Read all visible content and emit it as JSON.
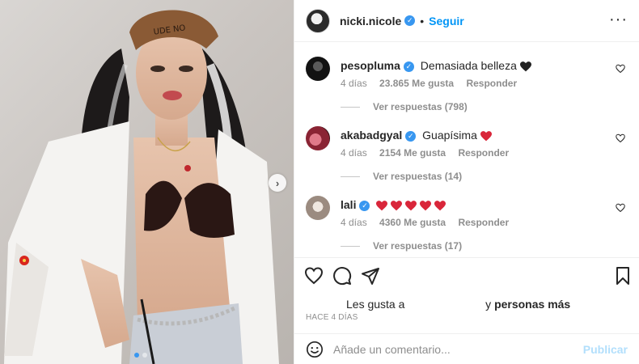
{
  "post": {
    "author": "nicki.nicole",
    "follow_label": "Seguir",
    "separator": "•",
    "more_label": "···"
  },
  "carousel": {
    "next_icon": "chevron-right-icon",
    "slide_count": 2,
    "active_slide": 1
  },
  "comments": [
    {
      "username": "pesopluma",
      "text": "Demasiada belleza",
      "emoji": [
        "black-heart"
      ],
      "time": "4 días",
      "likes": "23.865 Me gusta",
      "reply_label": "Responder",
      "replies": "Ver respuestas (798)"
    },
    {
      "username": "akabadgyal",
      "text": "Guapísima",
      "emoji": [
        "red-heart"
      ],
      "time": "4 días",
      "likes": "2154 Me gusta",
      "reply_label": "Responder",
      "replies": "Ver respuestas (14)"
    },
    {
      "username": "lali",
      "text": "",
      "emoji": [
        "red-heart",
        "red-heart",
        "red-heart",
        "red-heart",
        "red-heart"
      ],
      "time": "4 días",
      "likes": "4360 Me gusta",
      "reply_label": "Responder",
      "replies": "Ver respuestas (17)"
    }
  ],
  "likes_line": {
    "prefix": "Les gusta a",
    "suffix_and": "y",
    "suffix_rest": "personas más"
  },
  "posted_time": "HACE 4 DÍAS",
  "add_comment": {
    "placeholder": "Añade un comentario...",
    "publish_label": "Publicar"
  },
  "colors": {
    "accent": "#0095f6",
    "verified": "#3897f0",
    "heart_red": "#ed4956",
    "publish_disabled": "#b2dffc"
  }
}
